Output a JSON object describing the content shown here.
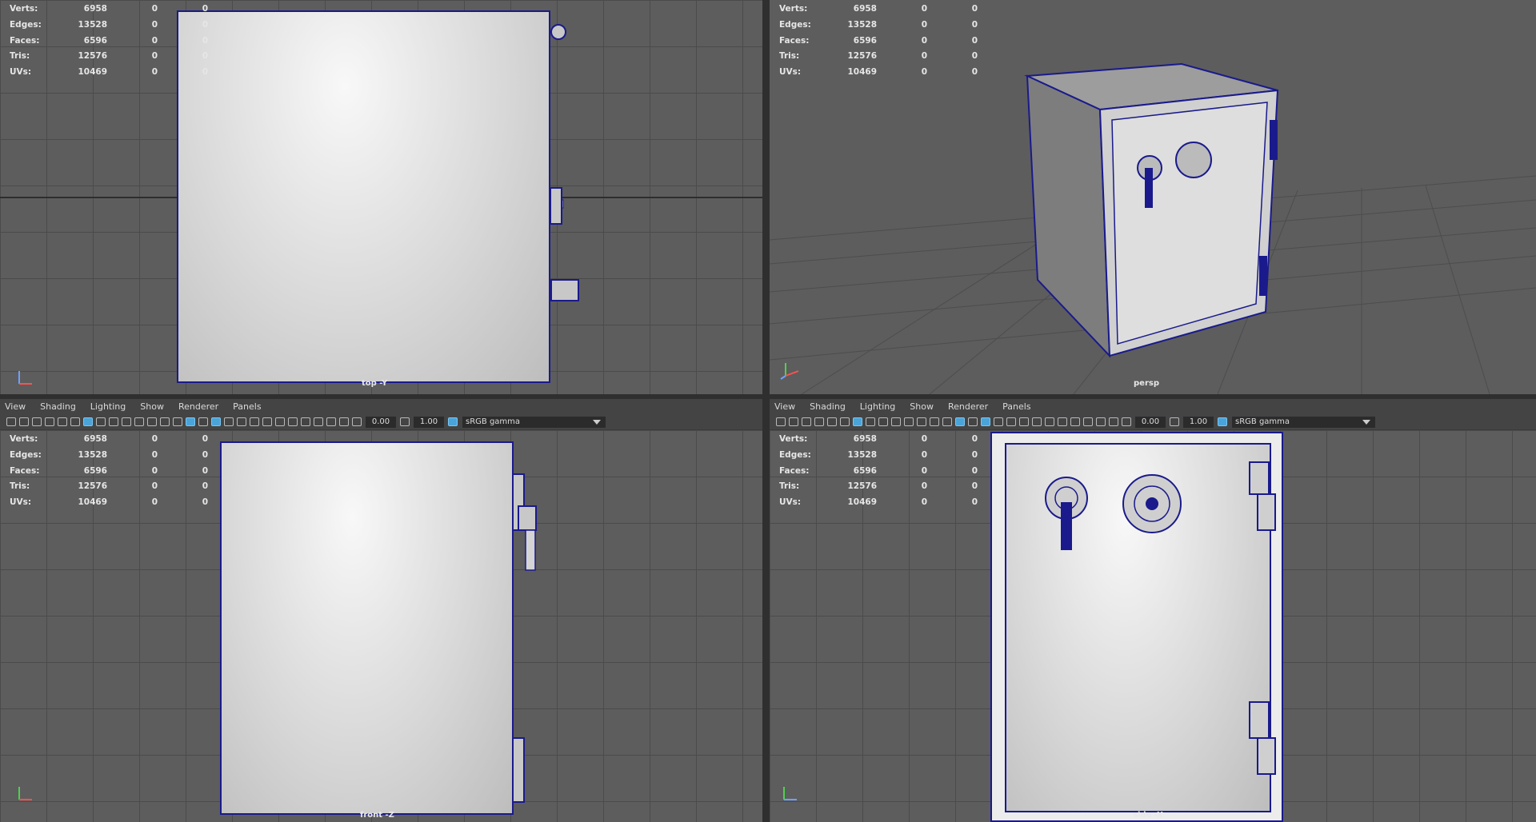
{
  "stats": {
    "labels": [
      "Verts:",
      "Edges:",
      "Faces:",
      "Tris:",
      "UVs:"
    ],
    "values": [
      "6958",
      "13528",
      "6596",
      "12576",
      "10469"
    ],
    "zero": "0"
  },
  "viewports": {
    "top": {
      "camera": "top -Y"
    },
    "persp": {
      "camera": "persp"
    },
    "front": {
      "camera": "front -Z"
    },
    "side": {
      "camera": "side -X"
    }
  },
  "panel_menu": {
    "items": [
      "View",
      "Shading",
      "Lighting",
      "Show",
      "Renderer",
      "Panels"
    ]
  },
  "toolbar": {
    "exposure": "0.00",
    "gamma": "1.00",
    "colorspace": "sRGB gamma"
  },
  "colors": {
    "wire": "#1a1a8c",
    "viewport_bg": "#5d5d5d",
    "accent": "#4aa4d9"
  }
}
